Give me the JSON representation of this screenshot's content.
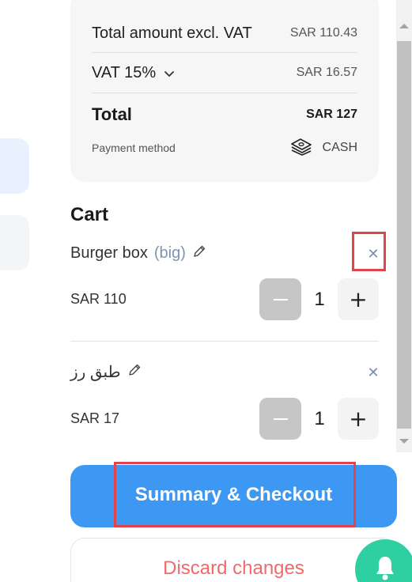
{
  "summary": {
    "subtotal_label": "Total amount excl. VAT",
    "subtotal_value": "SAR 110.43",
    "vat_label": "VAT 15%",
    "vat_value": "SAR 16.57",
    "total_label": "Total",
    "total_value": "SAR 127",
    "payment_label": "Payment method",
    "payment_value": "CASH",
    "payment_icon": "cash-stack-icon",
    "vat_toggle_icon": "chevron-down-icon"
  },
  "cart": {
    "title": "Cart",
    "items": [
      {
        "name": "Burger box",
        "variant": "(big)",
        "price": "SAR 110",
        "quantity": "1"
      },
      {
        "name": "طبق رز",
        "variant": "",
        "price": "SAR 17",
        "quantity": "1"
      }
    ]
  },
  "actions": {
    "checkout_label": "Summary & Checkout",
    "discard_label": "Discard changes"
  },
  "colors": {
    "primary": "#3d98f4",
    "danger_text": "#f06a6a",
    "fab": "#2ecfa0",
    "highlight": "#e0454d"
  }
}
